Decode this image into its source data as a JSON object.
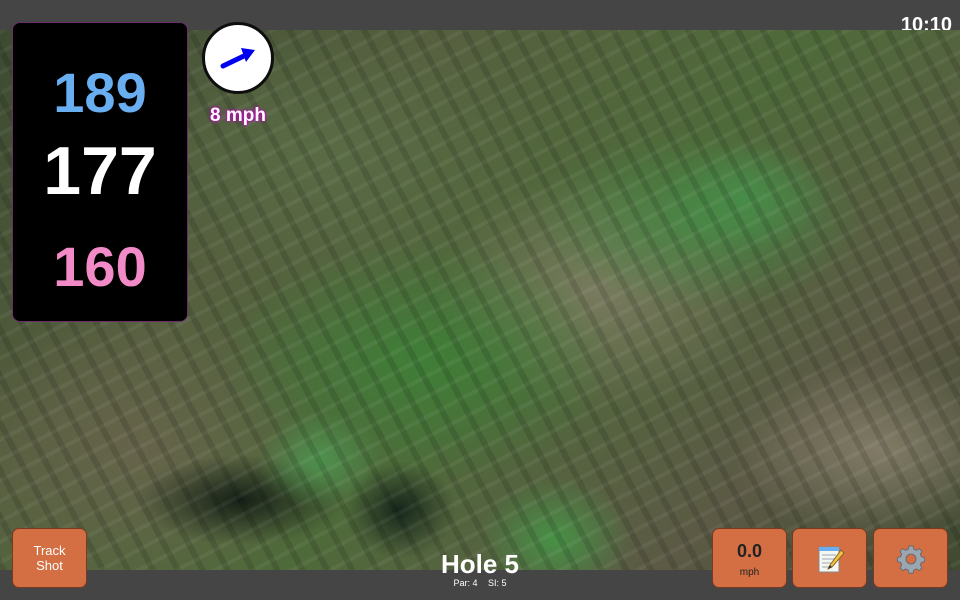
{
  "status": {
    "time": "10:10"
  },
  "distances": {
    "back": "189",
    "middle": "177",
    "front": "160"
  },
  "wind": {
    "speed": "8 mph",
    "direction_icon": "wind-arrow-icon"
  },
  "hole": {
    "title": "Hole 5",
    "par": "Par: 4",
    "si": "SI: 5"
  },
  "buttons": {
    "track_shot_line1": "Track",
    "track_shot_line2": "Shot",
    "speed_value": "0.0",
    "speed_unit": "mph",
    "notes_icon": "notepad-icon",
    "settings_icon": "gear-icon"
  },
  "colors": {
    "back_distance": "#6aaef2",
    "middle_distance": "#ffffff",
    "front_distance": "#f28ac8",
    "button_orange": "#d36f43",
    "wind_arrow": "#0000ee"
  }
}
